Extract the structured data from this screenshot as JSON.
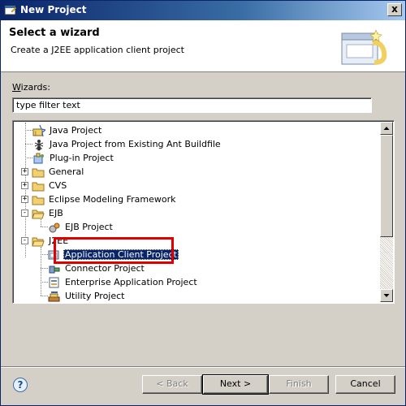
{
  "window": {
    "title": "New Project",
    "close_glyph": "x"
  },
  "banner": {
    "heading": "Select a wizard",
    "description": "Create a J2EE application client project"
  },
  "wizards": {
    "label_accel": "W",
    "label_rest": "izards:",
    "filter_value": "type filter text"
  },
  "tree": [
    {
      "label": "Java Project",
      "icon": "java-project-icon"
    },
    {
      "label": "Java Project from Existing Ant Buildfile",
      "icon": "ant-icon"
    },
    {
      "label": "Plug-in Project",
      "icon": "plugin-project-icon"
    },
    {
      "label": "General",
      "icon": "folder-icon",
      "expander": "+"
    },
    {
      "label": "CVS",
      "icon": "folder-icon",
      "expander": "+"
    },
    {
      "label": "Eclipse Modeling Framework",
      "icon": "folder-icon",
      "expander": "+"
    },
    {
      "label": "EJB",
      "icon": "folder-open-icon",
      "expander": "-"
    },
    {
      "label": "EJB Project",
      "icon": "ejb-project-icon"
    },
    {
      "label": "J2EE",
      "icon": "folder-open-icon",
      "expander": "-"
    },
    {
      "label": "Application Client Project",
      "icon": "app-client-project-icon",
      "selected": true
    },
    {
      "label": "Connector Project",
      "icon": "connector-project-icon"
    },
    {
      "label": "Enterprise Application Project",
      "icon": "enterprise-app-project-icon"
    },
    {
      "label": "Utility Project",
      "icon": "utility-project-icon"
    }
  ],
  "buttons": {
    "help": "?",
    "back": "< Back",
    "next": "Next >",
    "finish": "Finish",
    "cancel": "Cancel"
  },
  "colors": {
    "selection": "#0a246a",
    "annotation": "#e00000",
    "titlebar": "#0a246a"
  }
}
